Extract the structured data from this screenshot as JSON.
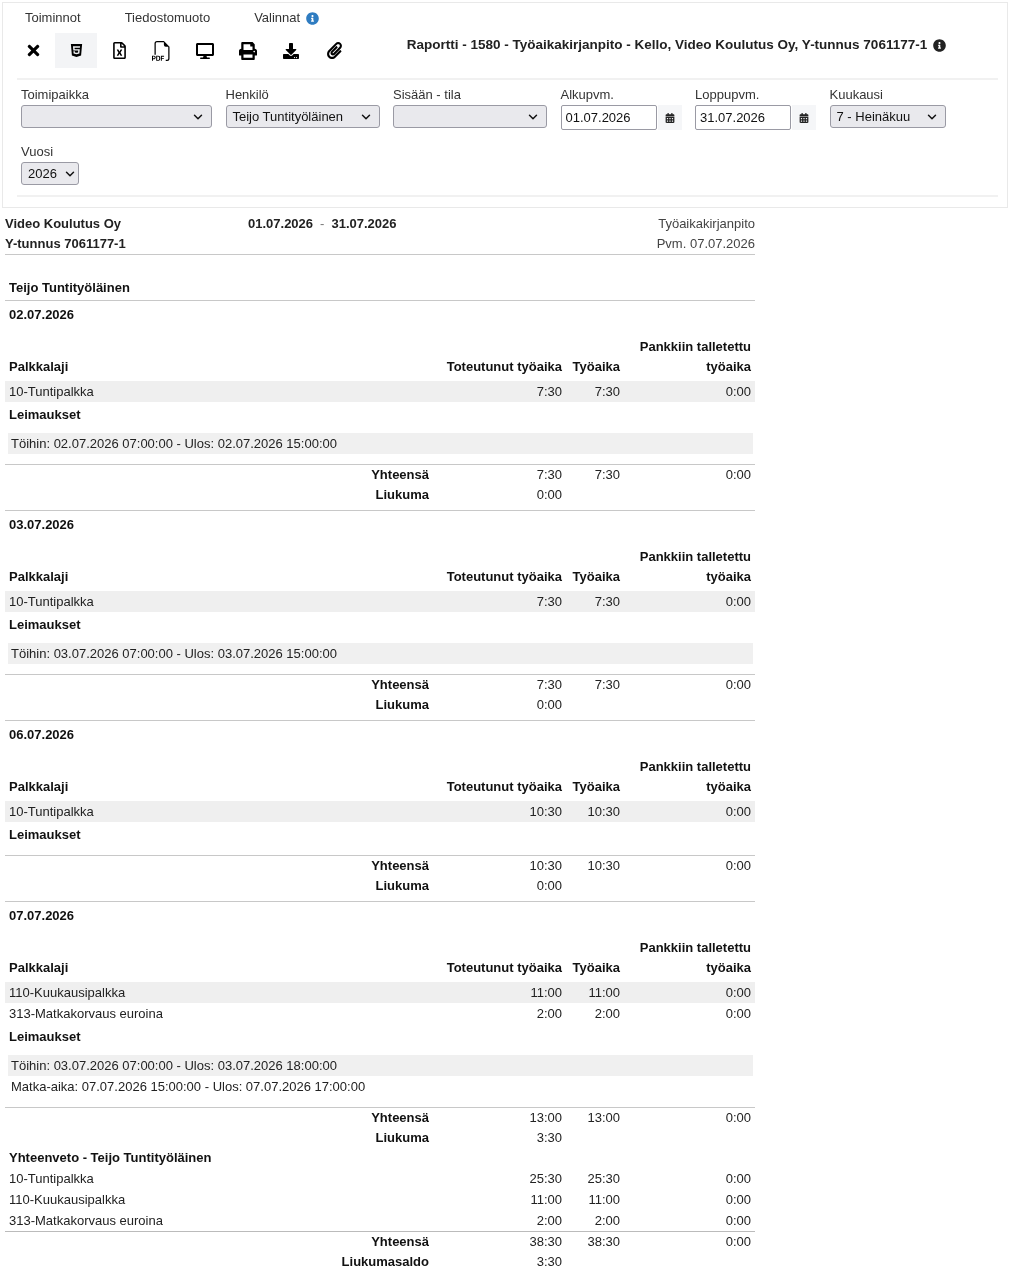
{
  "menu": [
    {
      "label": "Toiminnot",
      "info": false
    },
    {
      "label": "Tiedostomuoto",
      "info": false
    },
    {
      "label": "Valinnat",
      "info": true
    }
  ],
  "toolbar": [
    {
      "kind": "close",
      "selected": false
    },
    {
      "kind": "html",
      "selected": true
    },
    {
      "kind": "excel",
      "selected": false
    },
    {
      "kind": "pdf",
      "selected": false
    },
    {
      "kind": "screen",
      "selected": false
    },
    {
      "kind": "print",
      "selected": false
    },
    {
      "kind": "download",
      "selected": false
    },
    {
      "kind": "attach",
      "selected": false
    }
  ],
  "title": {
    "text": "Raportti - 1580 - Työaikakirjanpito - Kello, Video Koulutus Oy, Y-tunnus 7061177-1",
    "info": true
  },
  "filters": [
    {
      "kind": "select",
      "label": "Toimipaikka"
    },
    {
      "kind": "select",
      "label": "Henkilö",
      "value": "Teijo Tuntityöläinen"
    },
    {
      "kind": "select",
      "label": "Sisään - tila"
    },
    {
      "kind": "date",
      "label": "Alkupvm.",
      "value": "01.07.2026"
    },
    {
      "kind": "date",
      "label": "Loppupvm.",
      "value": "31.07.2026"
    },
    {
      "kind": "select",
      "label": "Kuukausi",
      "value": "7 - Heinäkuu"
    },
    {
      "kind": "select",
      "label": "Vuosi",
      "value": "2026"
    }
  ],
  "report": {
    "company": "Video Koulutus Oy",
    "business_id": "Y-tunnus 7061177-1",
    "period": {
      "start": "01.07.2026",
      "separator": "-",
      "end": "31.07.2026"
    },
    "report_name": "Työaikakirjanpito",
    "print_date": "Pvm. 07.07.2026",
    "person": "Teijo Tuntityöläinen",
    "days": [
      {
        "date": "02.07.2026",
        "columns": [
          "Palkkalaji",
          "Toteutunut työaika",
          "Työaika",
          "Pankkiin talletettu työaika"
        ],
        "rows": [
          [
            "10-Tuntipalkka",
            "7:30",
            "7:30",
            "0:00"
          ]
        ],
        "stamps_label": "Leimaukset",
        "stamps": [
          "Töihin: 02.07.2026 07:00:00 - Ulos: 02.07.2026 15:00:00"
        ],
        "total": {
          "label": "Yhteensä",
          "values": [
            "7:30",
            "7:30",
            "0:00"
          ]
        },
        "flex": {
          "label": "Liukuma",
          "value": "0:00"
        }
      },
      {
        "date": "03.07.2026",
        "columns": [
          "Palkkalaji",
          "Toteutunut työaika",
          "Työaika",
          "Pankkiin talletettu työaika"
        ],
        "rows": [
          [
            "10-Tuntipalkka",
            "7:30",
            "7:30",
            "0:00"
          ]
        ],
        "stamps_label": "Leimaukset",
        "stamps": [
          "Töihin: 03.07.2026 07:00:00 - Ulos: 03.07.2026 15:00:00"
        ],
        "total": {
          "label": "Yhteensä",
          "values": [
            "7:30",
            "7:30",
            "0:00"
          ]
        },
        "flex": {
          "label": "Liukuma",
          "value": "0:00"
        }
      },
      {
        "date": "06.07.2026",
        "columns": [
          "Palkkalaji",
          "Toteutunut työaika",
          "Työaika",
          "Pankkiin talletettu työaika"
        ],
        "rows": [
          [
            "10-Tuntipalkka",
            "10:30",
            "10:30",
            "0:00"
          ]
        ],
        "stamps_label": "Leimaukset",
        "total": {
          "label": "Yhteensä",
          "values": [
            "10:30",
            "10:30",
            "0:00"
          ]
        },
        "flex": {
          "label": "Liukuma",
          "value": "0:00"
        }
      },
      {
        "date": "07.07.2026",
        "columns": [
          "Palkkalaji",
          "Toteutunut työaika",
          "Työaika",
          "Pankkiin talletettu työaika"
        ],
        "rows": [
          [
            "110-Kuukausipalkka",
            "11:00",
            "11:00",
            "0:00"
          ],
          [
            "313-Matkakorvaus euroina",
            "2:00",
            "2:00",
            "0:00"
          ]
        ],
        "stamps_label": "Leimaukset",
        "stamps": [
          "Töihin: 03.07.2026 07:00:00 - Ulos: 03.07.2026 18:00:00",
          "Matka-aika: 07.07.2026 15:00:00 - Ulos: 07.07.2026 17:00:00"
        ],
        "total": {
          "label": "Yhteensä",
          "values": [
            "13:00",
            "13:00",
            "0:00"
          ]
        },
        "flex": {
          "label": "Liukuma",
          "value": "3:30"
        }
      }
    ],
    "summary": {
      "title": "Yhteenveto - Teijo Tuntityöläinen",
      "rows": [
        [
          "10-Tuntipalkka",
          "25:30",
          "25:30",
          "0:00"
        ],
        [
          "110-Kuukausipalkka",
          "11:00",
          "11:00",
          "0:00"
        ],
        [
          "313-Matkakorvaus euroina",
          "2:00",
          "2:00",
          "0:00"
        ]
      ],
      "total": {
        "label": "Yhteensä",
        "values": [
          "38:30",
          "38:30",
          "0:00"
        ]
      },
      "balance": {
        "label": "Liukumasaldo",
        "value": "3:30"
      }
    }
  }
}
